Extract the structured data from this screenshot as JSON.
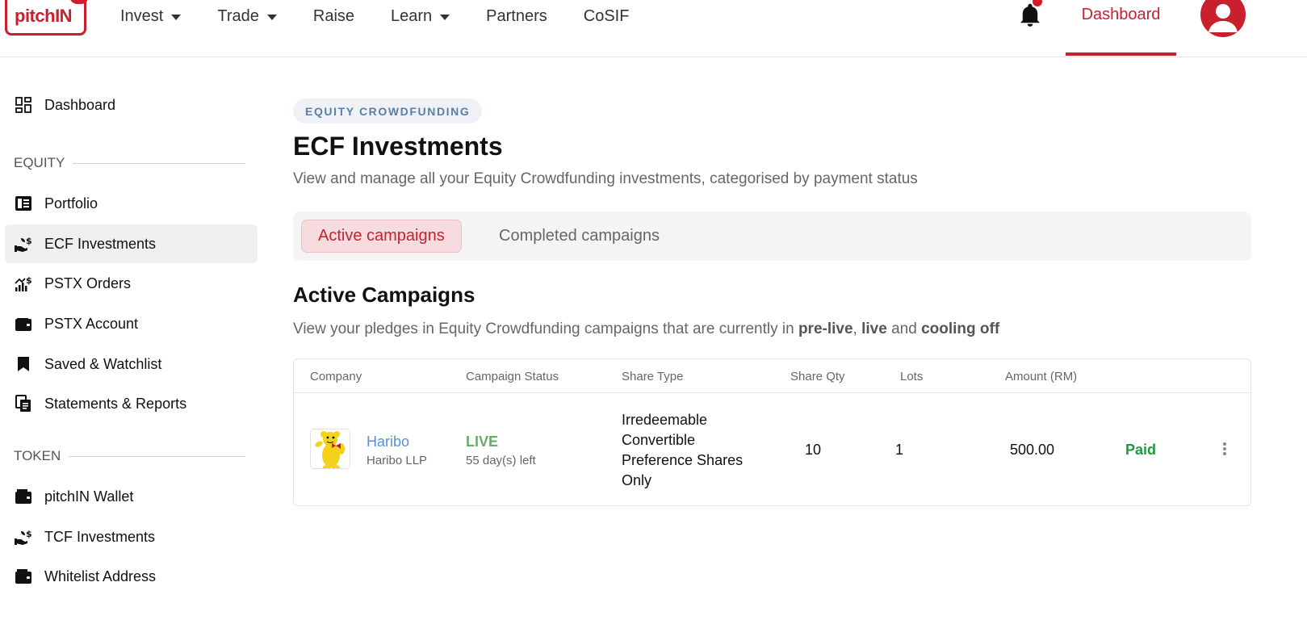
{
  "header": {
    "logo_text_pitch": "pitch",
    "logo_text_in": "IN",
    "nav": [
      {
        "label": "Invest",
        "dropdown": true
      },
      {
        "label": "Trade",
        "dropdown": true
      },
      {
        "label": "Raise",
        "dropdown": false
      },
      {
        "label": "Learn",
        "dropdown": true
      },
      {
        "label": "Partners",
        "dropdown": false
      },
      {
        "label": "CoSIF",
        "dropdown": false
      }
    ],
    "dashboard_label": "Dashboard",
    "icons": {
      "notifications": "bell-icon",
      "profile": "user-avatar-icon",
      "dropdown": "caret-down-icon"
    }
  },
  "sidebar": {
    "dashboard": {
      "label": "Dashboard",
      "icon": "dashboard-grid-icon"
    },
    "equity_section": "EQUITY",
    "equity_items": [
      {
        "label": "Portfolio",
        "icon": "portfolio-icon"
      },
      {
        "label": "ECF Investments",
        "icon": "investment-plant-icon",
        "active": true
      },
      {
        "label": "PSTX Orders",
        "icon": "orders-chart-icon"
      },
      {
        "label": "PSTX Account",
        "icon": "wallet-icon"
      },
      {
        "label": "Saved & Watchlist",
        "icon": "bookmark-icon"
      },
      {
        "label": "Statements & Reports",
        "icon": "documents-icon"
      }
    ],
    "token_section": "TOKEN",
    "token_items": [
      {
        "label": "pitchIN Wallet",
        "icon": "wallet-icon"
      },
      {
        "label": "TCF Investments",
        "icon": "investment-plant-icon"
      },
      {
        "label": "Whitelist Address",
        "icon": "wallet-icon"
      }
    ]
  },
  "main": {
    "badge": "EQUITY CROWDFUNDING",
    "title": "ECF Investments",
    "subtitle": "View and manage all your Equity Crowdfunding investments, categorised by payment status",
    "tabs": [
      {
        "label": "Active campaigns",
        "active": true
      },
      {
        "label": "Completed campaigns",
        "active": false
      }
    ],
    "section_title": "Active Campaigns",
    "section_sub_prefix": "View your pledges in Equity Crowdfunding campaigns that are currently in ",
    "section_sub_b1": "pre-live",
    "section_sub_sep1": ", ",
    "section_sub_b2": "live",
    "section_sub_sep2": " and ",
    "section_sub_b3": "cooling off"
  },
  "table": {
    "columns": [
      "Company",
      "Campaign Status",
      "Share Type",
      "Share Qty",
      "Lots",
      "Amount (RM)"
    ],
    "rows": [
      {
        "company": "Haribo",
        "company_sub": "Haribo LLP",
        "logo": "haribo-bear-logo",
        "status": "LIVE",
        "days_left": "55 day(s) left",
        "share_type": "Irredeemable Convertible Preference Shares Only",
        "share_qty": "10",
        "lots": "1",
        "amount": "500.00",
        "payment": "Paid"
      }
    ]
  },
  "colors": {
    "brand": "#c8202f",
    "paid": "#1e9a3f",
    "live": "#6aaa6a",
    "link": "#5b8fd6"
  }
}
